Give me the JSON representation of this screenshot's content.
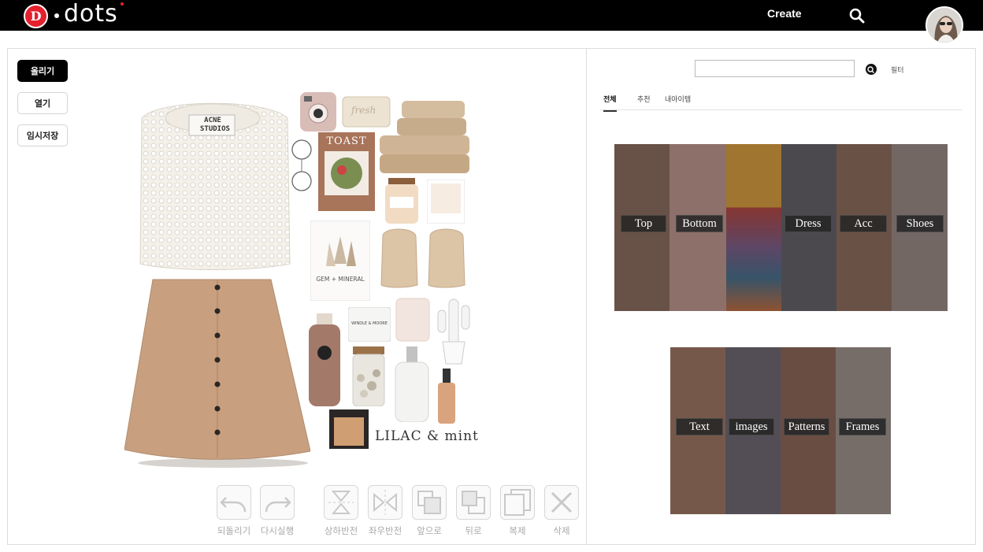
{
  "header": {
    "logo_letter": "D",
    "logo_text": "dots",
    "create_label": "Create",
    "search_icon": "search-icon",
    "avatar": "user-avatar"
  },
  "side_actions": {
    "upload_label": "올리기",
    "open_label": "열기",
    "temp_save_label": "임시저장"
  },
  "collage": {
    "sweater_label": "ACNE STUDIOS",
    "book_title": "TOAST",
    "calendar_text": "GEM + MINERAL",
    "soap_text": "fresh",
    "brand_text": "LILAC & mint",
    "candle_text": "WINDLE & MOORE"
  },
  "toolbar": [
    {
      "icon": "undo-icon",
      "label": "되돌리기"
    },
    {
      "icon": "redo-icon",
      "label": "다시실행"
    },
    {
      "icon": "flip-vertical-icon",
      "label": "상하반전"
    },
    {
      "icon": "flip-horizontal-icon",
      "label": "좌우반전"
    },
    {
      "icon": "bring-forward-icon",
      "label": "앞으로"
    },
    {
      "icon": "send-backward-icon",
      "label": "뒤로"
    },
    {
      "icon": "duplicate-icon",
      "label": "복제"
    },
    {
      "icon": "delete-icon",
      "label": "삭제"
    }
  ],
  "right_panel": {
    "search_value": "",
    "filter_label": "필터",
    "tabs": [
      "전체",
      "추천",
      "내아이템"
    ],
    "active_tab": "전체",
    "categories": [
      "Top",
      "Bottom",
      "Dress",
      "Acc",
      "Shoes"
    ],
    "extras": [
      "Text",
      "images",
      "Patterns",
      "Frames"
    ]
  },
  "colors": {
    "topbar": "#000000",
    "brand_red": "#e5202e",
    "border": "#dcdcdc",
    "button_primary": "#000000",
    "toolbar_label": "#a9a9a9",
    "category_button": "#262626"
  }
}
